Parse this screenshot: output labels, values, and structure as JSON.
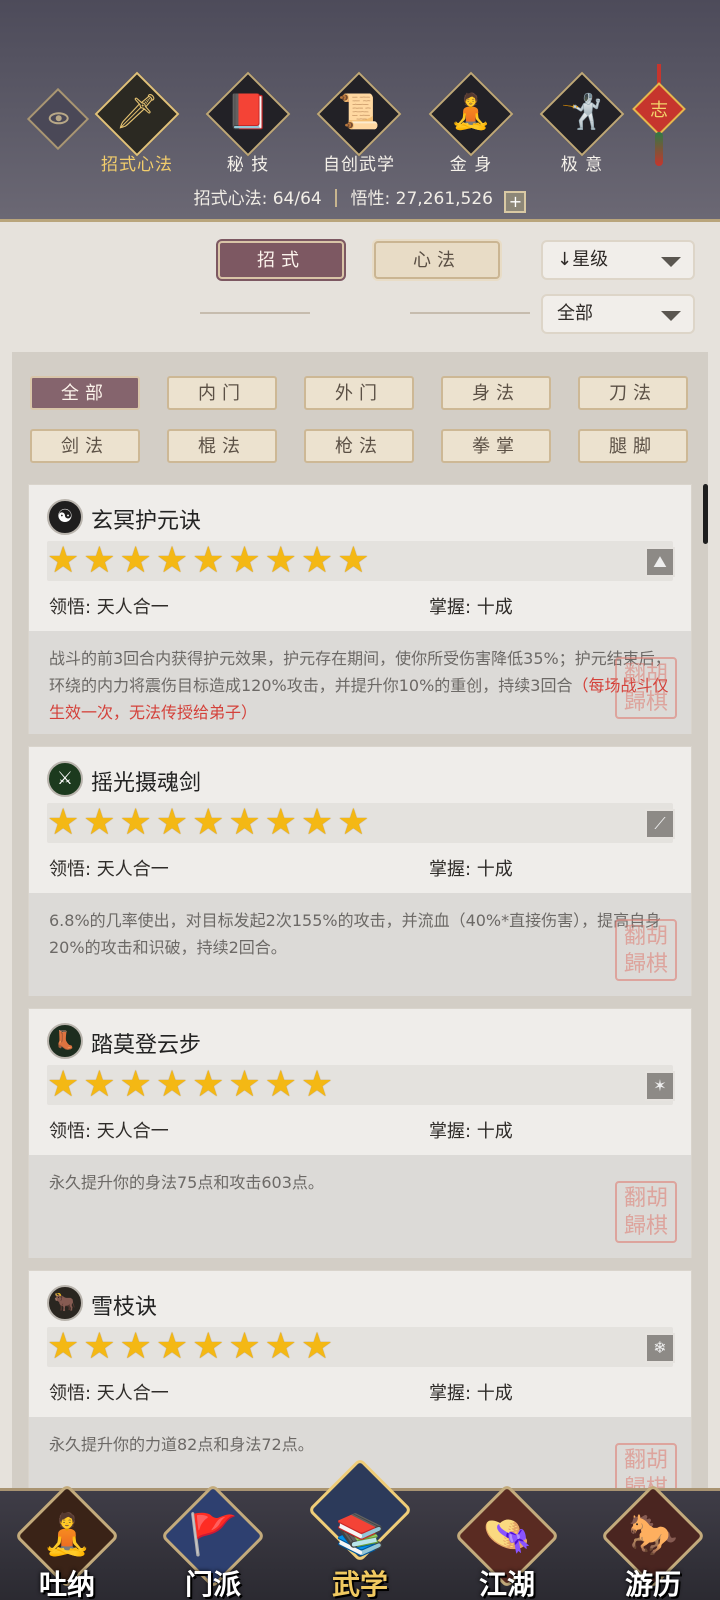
{
  "header": {
    "categories": [
      {
        "label": "招式心法",
        "icon": "sword-icon",
        "glyph": "🗡"
      },
      {
        "label": "秘 技",
        "icon": "book-icon",
        "glyph": "📕"
      },
      {
        "label": "自创武学",
        "icon": "scroll-icon",
        "glyph": "📜"
      },
      {
        "label": "金 身",
        "icon": "meditation-icon",
        "glyph": "🧘"
      },
      {
        "label": "极 意",
        "icon": "martial-pose-icon",
        "glyph": "🤺"
      }
    ],
    "knot_text": "志",
    "stats": {
      "moves_label": "招式心法: 64/64",
      "insight_label": "悟性: 27,261,526",
      "plus": "+"
    }
  },
  "filters": {
    "tab_moves": "招式",
    "tab_heart": "心法",
    "sort_label": "↓星级",
    "scope_label": "全部"
  },
  "sub_tabs": [
    "全部",
    "内门",
    "外门",
    "身法",
    "刀法",
    "剑法",
    "棍法",
    "枪法",
    "拳掌",
    "腿脚"
  ],
  "skills": [
    {
      "name": "玄冥护元诀",
      "icon": "yin-yang-icon",
      "icon_glyph": "☯",
      "stars": 9,
      "type_icon": "inner-art-icon",
      "comprehension": "领悟: 天人合一",
      "mastery": "掌握: 十成",
      "desc": "战斗的前3回合内获得护元效果，护元存在期间，使你所受伤害降低35%；护元结束后，环绕的内力将震伤目标造成120%攻击，并提升你10%的重创，持续3回合",
      "desc_note": "（每场战斗仅生效一次，无法传授给弟子）"
    },
    {
      "name": "摇光摄魂剑",
      "icon": "green-blade-icon",
      "icon_glyph": "⚔",
      "stars": 9,
      "type_icon": "sword-type-icon",
      "comprehension": "领悟: 天人合一",
      "mastery": "掌握: 十成",
      "desc": "6.8%的几率使出，对目标发起2次155%的攻击，并流血（40%*直接伤害），提高自身20%的攻击和识破，持续2回合。",
      "desc_note": ""
    },
    {
      "name": "踏莫登云步",
      "icon": "boot-icon",
      "icon_glyph": "👢",
      "stars": 8,
      "type_icon": "movement-type-icon",
      "comprehension": "领悟: 天人合一",
      "mastery": "掌握: 十成",
      "desc": "永久提升你的身法75点和攻击603点。",
      "desc_note": ""
    },
    {
      "name": "雪枝诀",
      "icon": "bull-head-icon",
      "icon_glyph": "🐂",
      "stars": 8,
      "type_icon": "snowflake-type-icon",
      "comprehension": "领悟: 天人合一",
      "mastery": "掌握: 十成",
      "desc": "永久提升你的力道82点和身法72点。",
      "desc_note": ""
    }
  ],
  "seal_text": "翻胡\n歸棋",
  "bottom_nav": [
    {
      "label": "吐纳",
      "icon": "monk-icon",
      "glyph": "🧘"
    },
    {
      "label": "门派",
      "icon": "flags-icon",
      "glyph": "🚩"
    },
    {
      "label": "武学",
      "icon": "books-icon",
      "glyph": "📚"
    },
    {
      "label": "江湖",
      "icon": "straw-hat-icon",
      "glyph": "👒"
    },
    {
      "label": "游历",
      "icon": "horse-icon",
      "glyph": "🐎"
    }
  ],
  "colors": {
    "accent_gold": "#e5c271",
    "active_pill": "#7d5862",
    "star": "#f4b814",
    "note_red": "#d4413a"
  }
}
